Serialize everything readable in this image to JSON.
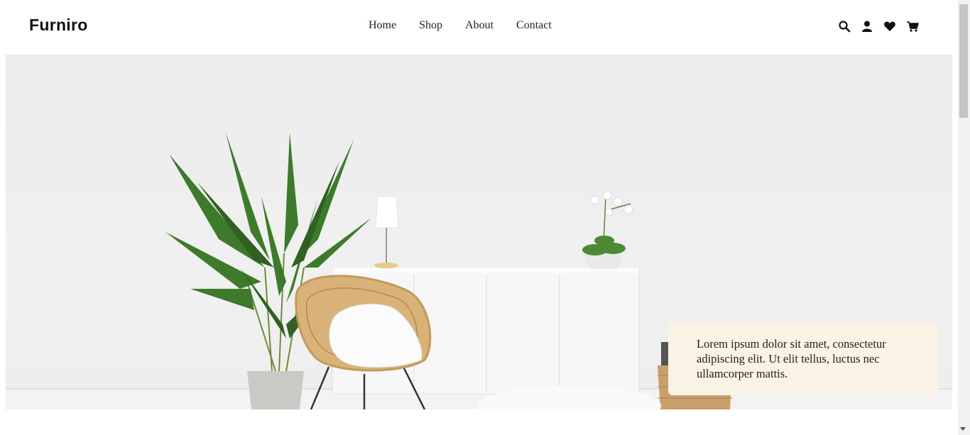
{
  "brand": {
    "name": "Furniro"
  },
  "nav": {
    "items": [
      "Home",
      "Shop",
      "About",
      "Contact"
    ]
  },
  "header_icons": [
    "search-icon",
    "user-icon",
    "heart-icon",
    "cart-icon"
  ],
  "hero": {
    "caption": "Lorem ipsum dolor sit amet, consectetur adipiscing elit. Ut elit tellus, luctus nec ullamcorper mattis."
  },
  "colors": {
    "card_bg": "#fbf2e6",
    "wall": "#eeeeee",
    "plant": "#3d7a2a",
    "rattan": "#d9b27a"
  }
}
